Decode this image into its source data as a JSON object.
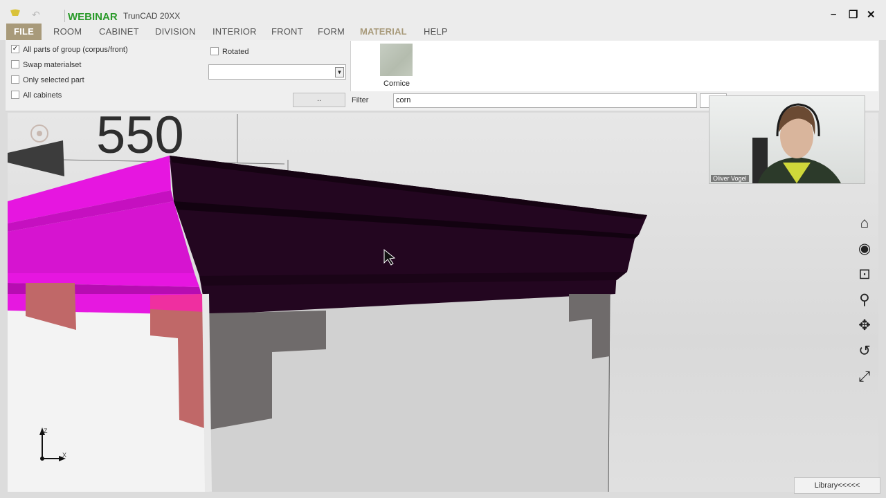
{
  "titlebar": {
    "brand": "WEBINAR",
    "app_title": "TrunCAD 20XX",
    "undo_icon": "↶",
    "minimize": "–",
    "restore": "❐",
    "close": "✕"
  },
  "menu": {
    "items": [
      "FILE",
      "ROOM",
      "CABINET",
      "DIVISION",
      "INTERIOR",
      "FRONT",
      "FORM",
      "MATERIAL",
      "HELP"
    ],
    "active": "MATERIAL",
    "accent_color": "#a89a7a"
  },
  "options": {
    "checkboxes": [
      {
        "label": "All parts of group (corpus/front)",
        "checked": true
      },
      {
        "label": "Swap materialset",
        "checked": false
      },
      {
        "label": "Only selected part",
        "checked": false
      },
      {
        "label": "All cabinets",
        "checked": false
      }
    ],
    "rotated": {
      "label": "Rotated",
      "checked": false
    },
    "dropdown_value": "",
    "dots_button": "..",
    "check_mark": "✓"
  },
  "material": {
    "swatch_label": "Cornice",
    "filter_label": "Filter",
    "filter_value": "corn"
  },
  "viewport": {
    "dimension_text": "550",
    "axis_z": "Z",
    "axis_x": "X",
    "colors": {
      "magenta": "#e616e0",
      "dark_cornice": "#230620",
      "pink_block": "#c06868",
      "grey_block": "#6f6b6b"
    }
  },
  "nav_icons": [
    "home-icon",
    "view-icon",
    "zoom-window-icon",
    "zoom-icon",
    "pan-icon",
    "rotate-icon",
    "fit-icon"
  ],
  "webcam": {
    "name": "Oliver Vogel"
  },
  "library_button": "Library<<<<<"
}
